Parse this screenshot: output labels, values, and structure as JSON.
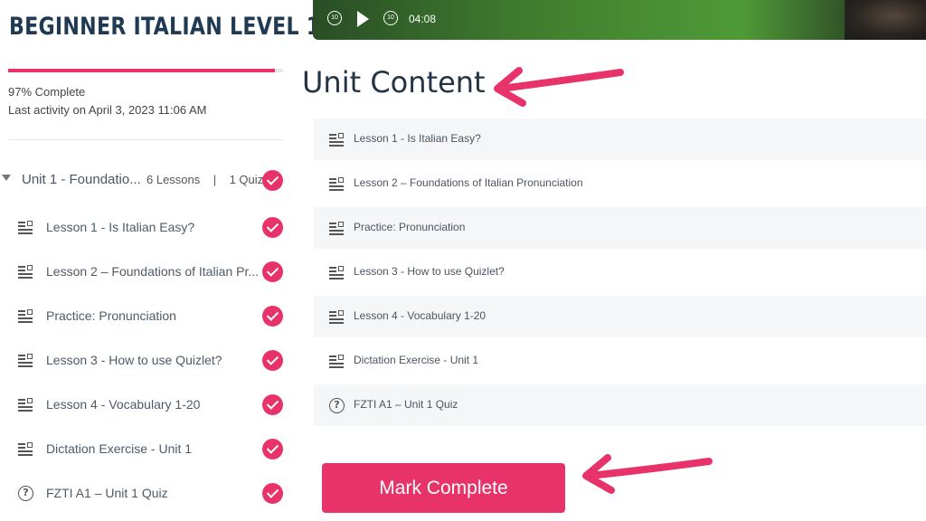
{
  "sidebar": {
    "course_title": "BEGINNER ITALIAN LEVEL 1",
    "progress_percent": 97,
    "progress_text": "97% Complete",
    "last_activity": "Last activity on April 3, 2023 11:06 AM",
    "unit": {
      "title": "Unit 1 - Foundatio...",
      "lessons": "6 Lessons",
      "separator": "|",
      "quiz": "1 Quiz"
    },
    "items": [
      {
        "label": "Lesson 1 - Is Italian Easy?",
        "icon": "lesson-icon"
      },
      {
        "label": "Lesson 2 – Foundations of Italian Pr...",
        "icon": "lesson-icon"
      },
      {
        "label": "Practice: Pronunciation",
        "icon": "lesson-icon"
      },
      {
        "label": "Lesson 3 - How to use Quizlet?",
        "icon": "lesson-icon"
      },
      {
        "label": "Lesson 4 - Vocabulary 1-20",
        "icon": "lesson-icon"
      },
      {
        "label": "Dictation Exercise - Unit 1",
        "icon": "lesson-icon"
      },
      {
        "label": "FZTI A1 – Unit 1 Quiz",
        "icon": "quiz-icon"
      }
    ]
  },
  "video": {
    "rewind_label": "10",
    "forward_label": "10",
    "time": "04:08"
  },
  "main": {
    "heading": "Unit Content",
    "rows": [
      {
        "label": "Lesson 1 - Is Italian Easy?",
        "icon": "lesson-icon"
      },
      {
        "label": "Lesson 2 – Foundations of Italian Pronunciation",
        "icon": "lesson-icon"
      },
      {
        "label": "Practice: Pronunciation",
        "icon": "lesson-icon"
      },
      {
        "label": "Lesson 3 - How to use Quizlet?",
        "icon": "lesson-icon"
      },
      {
        "label": "Lesson 4 - Vocabulary 1-20",
        "icon": "lesson-icon"
      },
      {
        "label": "Dictation Exercise - Unit 1",
        "icon": "lesson-icon"
      },
      {
        "label": "FZTI A1 – Unit 1 Quiz",
        "icon": "quiz-icon"
      }
    ],
    "mark_complete_label": "Mark Complete"
  },
  "colors": {
    "accent": "#e8336a",
    "title": "#1f3a52"
  }
}
